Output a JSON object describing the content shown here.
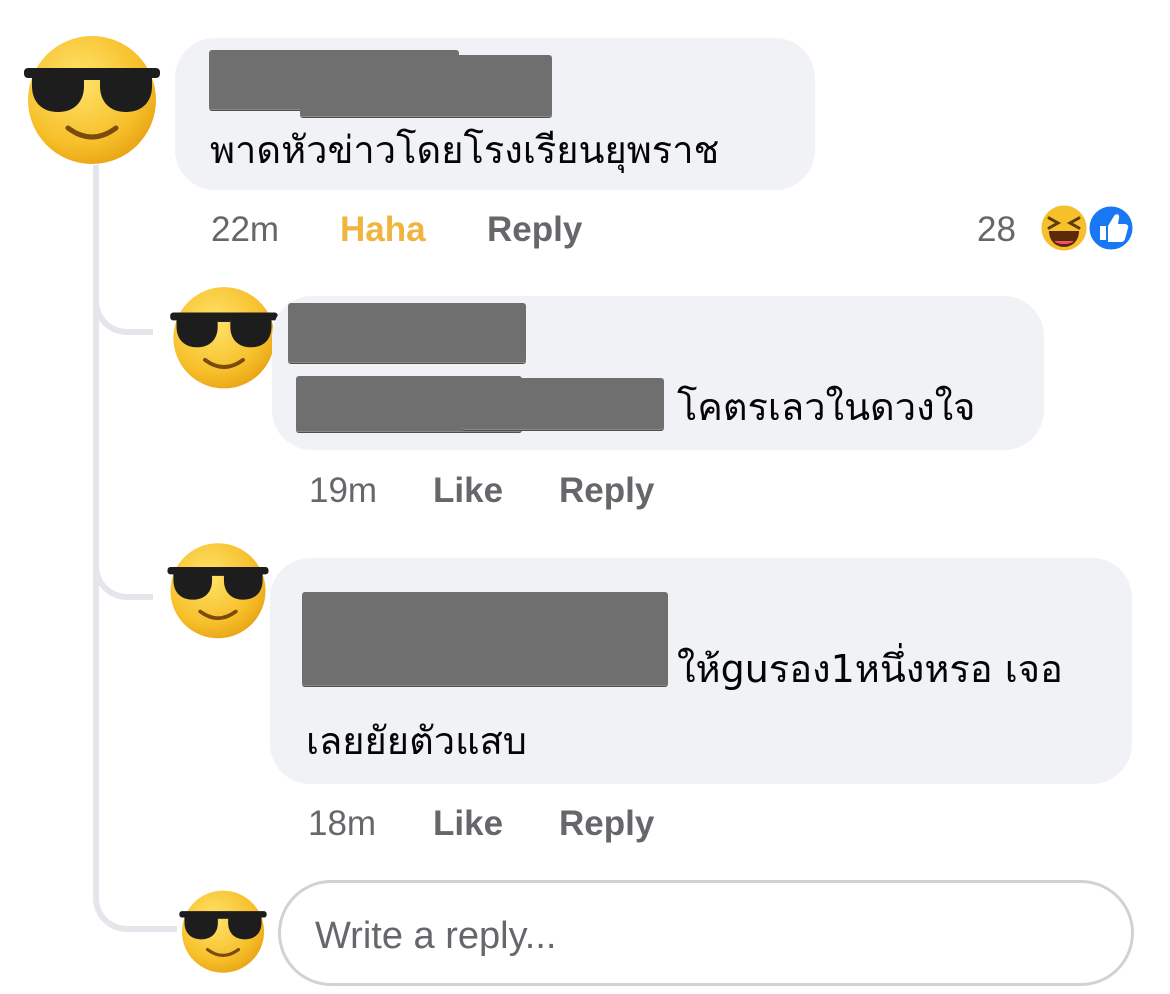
{
  "comment": {
    "text": "พาดหัวข่าวโดยโรงเรียนยุพราช",
    "time": "22m",
    "reaction_label": "Haha",
    "reply_label": "Reply",
    "reaction_count": "28",
    "reaction_icons": [
      "haha-emoji-icon",
      "like-thumb-icon"
    ]
  },
  "replies": [
    {
      "text_line1": "โคตรเลวในดวงใจ",
      "time": "19m",
      "like_label": "Like",
      "reply_label": "Reply"
    },
    {
      "text_line1": "ให้guรอง1หนึ่งหรอ เจอ",
      "text_line2": "เลยยัยตัวแสบ",
      "time": "18m",
      "like_label": "Like",
      "reply_label": "Reply"
    }
  ],
  "composer": {
    "placeholder": "Write a reply..."
  },
  "colors": {
    "bubble": "#f0f2f5",
    "haha": "#f0b53e",
    "meta_gray": "#65676b",
    "like_blue": "#1877f2"
  },
  "avatar_icon": "sunglasses-emoji-icon"
}
